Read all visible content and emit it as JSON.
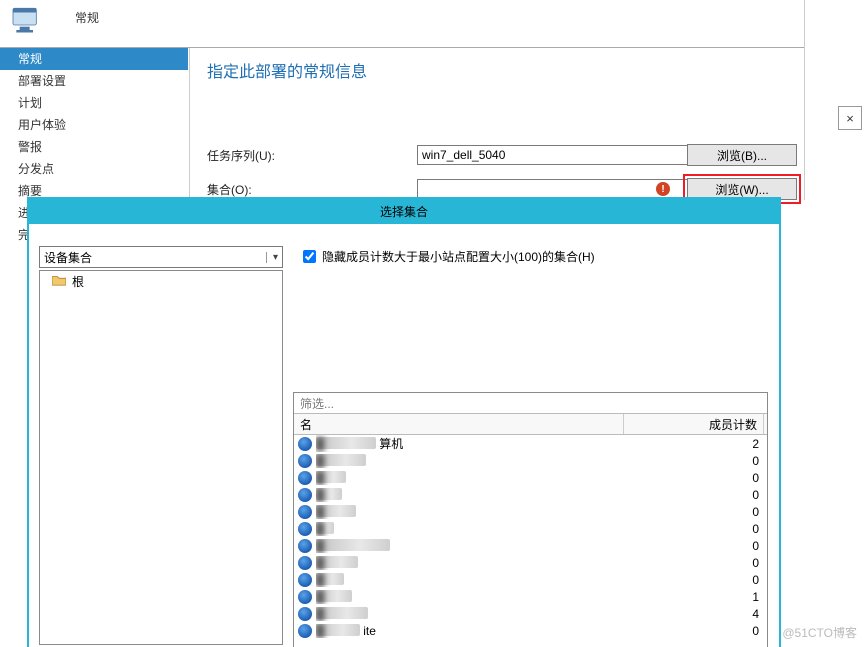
{
  "wizard": {
    "tab_label": "常规",
    "title": "指定此部署的常规信息",
    "nav": [
      {
        "label": "常规",
        "active": true
      },
      {
        "label": "部署设置"
      },
      {
        "label": "计划"
      },
      {
        "label": "用户体验"
      },
      {
        "label": "警报"
      },
      {
        "label": "分发点"
      },
      {
        "label": "摘要"
      },
      {
        "label": "进"
      },
      {
        "label": "完"
      }
    ],
    "closebox_glyph": "×",
    "rows": {
      "task_sequence": {
        "label": "任务序列(U):",
        "value": "win7_dell_5040",
        "browse_label": "浏览(B)..."
      },
      "collection": {
        "label": "集合(O):",
        "value": "",
        "browse_label": "浏览(W)..."
      }
    },
    "error_glyph": "!"
  },
  "dialog": {
    "title": "选择集合",
    "combo_value": "设备集合",
    "tree_root": "根",
    "hide_checkbox_label": "隐藏成员计数大于最小站点配置大小(100)的集合(H)",
    "filter_placeholder": "筛选...",
    "columns": {
      "name": "名",
      "count": "成员计数"
    },
    "rows": [
      {
        "name": "算机",
        "count": "2",
        "blur_w": 60
      },
      {
        "name": "",
        "count": "0",
        "blur_w": 50
      },
      {
        "name": "",
        "count": "0",
        "blur_w": 30
      },
      {
        "name": "",
        "count": "0",
        "blur_w": 26
      },
      {
        "name": "",
        "count": "0",
        "blur_w": 40
      },
      {
        "name": "",
        "count": "0",
        "blur_w": 18
      },
      {
        "name": "",
        "count": "0",
        "blur_w": 74
      },
      {
        "name": "",
        "count": "0",
        "blur_w": 42
      },
      {
        "name": "",
        "count": "0",
        "blur_w": 28
      },
      {
        "name": "",
        "count": "1",
        "blur_w": 36
      },
      {
        "name": "",
        "count": "4",
        "blur_w": 52
      },
      {
        "name": "ite",
        "count": "0",
        "blur_w": 44
      }
    ]
  },
  "watermark": "@51CTO博客"
}
